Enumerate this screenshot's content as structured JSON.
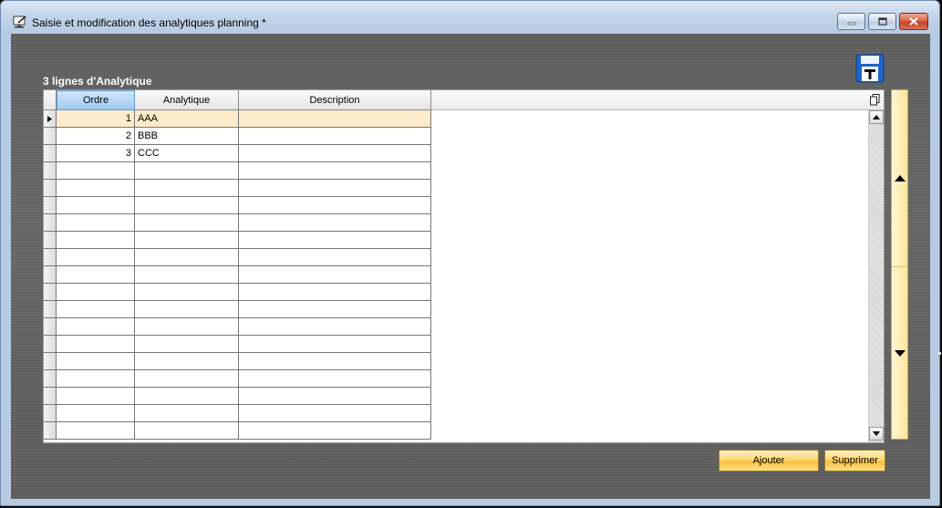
{
  "window": {
    "title": "Saisie et modification des analytiques planning *",
    "icons": {
      "app": "monitor-edit-icon",
      "minimize": "minimize-icon",
      "maximize": "maximize-icon",
      "close": "close-icon"
    }
  },
  "section": {
    "title": "3 lignes d'Analytique",
    "save_icon": "save-floppy-icon"
  },
  "grid": {
    "columns": [
      {
        "label": "Ordre"
      },
      {
        "label": "Analytique"
      },
      {
        "label": "Description"
      }
    ],
    "rows": [
      {
        "ordre": "1",
        "analytique": "AAA",
        "description": ""
      },
      {
        "ordre": "2",
        "analytique": "BBB",
        "description": ""
      },
      {
        "ordre": "3",
        "analytique": "CCC",
        "description": ""
      }
    ],
    "current_row_indicator_icon": "row-arrow-icon",
    "corner_icon": "copy-icon"
  },
  "navigation": {
    "up_icon": "arrow-up-icon",
    "down_icon": "arrow-down-icon"
  },
  "buttons": {
    "add_label": "Ajouter",
    "delete_label": "Supprimer"
  },
  "colors": {
    "current_row": "#fcebc8",
    "button_gold": "#ffd46b",
    "background": "#606060"
  }
}
